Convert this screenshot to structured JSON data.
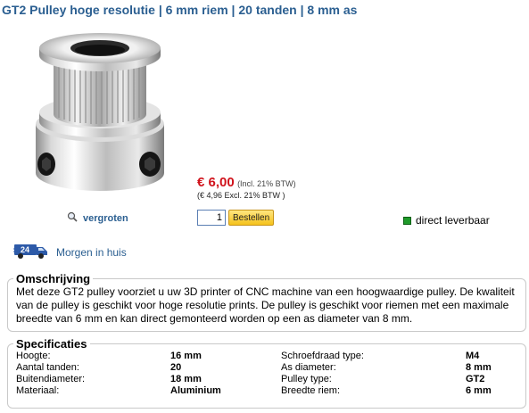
{
  "product": {
    "title": "GT2 Pulley hoge resolutie | 6 mm riem | 20 tanden | 8 mm as",
    "zoom_label": "vergroten"
  },
  "pricing": {
    "price": "€ 6,00",
    "incl_note": "(Incl. 21% BTW)",
    "excl_note": "(€ 4,96 Excl. 21% BTW )"
  },
  "order": {
    "quantity": "1",
    "button_label": "Bestellen"
  },
  "stock": {
    "label": "direct leverbaar",
    "color": "#1f9a2a"
  },
  "delivery": {
    "label": "Morgen in huis",
    "badge": "24",
    "icon": "delivery-van-icon"
  },
  "description": {
    "heading": "Omschrijving",
    "text": "Met deze GT2 pulley voorziet u uw 3D printer of CNC machine van een hoogwaardige pulley. De kwaliteit van de pulley is geschikt voor hoge resolutie prints. De pulley is geschikt voor riemen met een maximale breedte van 6 mm en kan direct gemonteerd worden op een as diameter van 8 mm."
  },
  "specs": {
    "heading": "Specificaties",
    "rows": [
      {
        "label": "Hoogte:",
        "value": "16 mm",
        "label2": "Schroefdraad type:",
        "value2": "M4"
      },
      {
        "label": "Aantal tanden:",
        "value": "20",
        "label2": "As diameter:",
        "value2": "8 mm"
      },
      {
        "label": "Buitendiameter:",
        "value": "18 mm",
        "label2": "Pulley type:",
        "value2": "GT2"
      },
      {
        "label": "Materiaal:",
        "value": "Aluminium",
        "label2": "Breedte riem:",
        "value2": "6 mm"
      }
    ]
  },
  "colors": {
    "title_blue": "#2b5f91",
    "price_red": "#d0121b",
    "button_yellow": "#f5c21b"
  }
}
